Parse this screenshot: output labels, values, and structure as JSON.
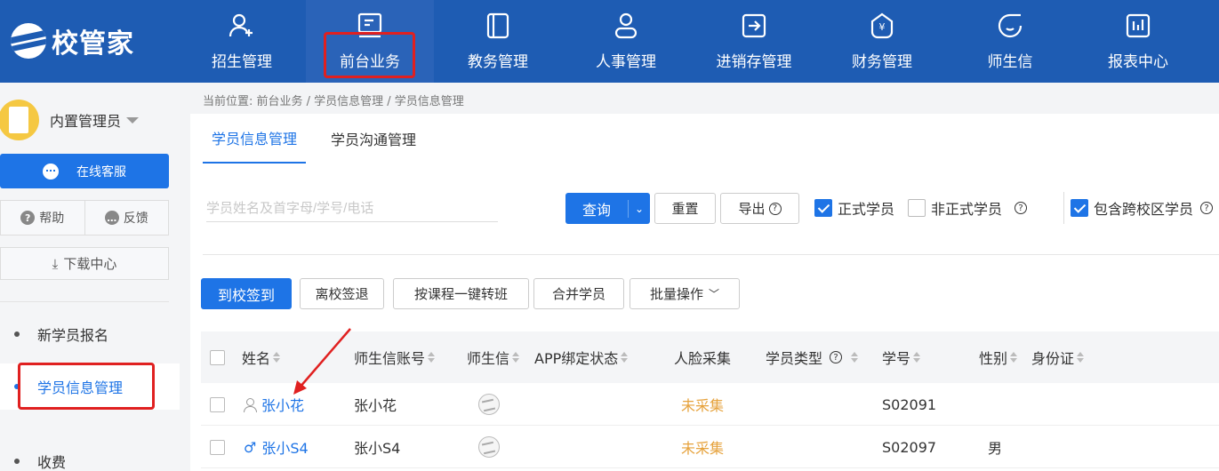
{
  "brand": {
    "name": "校管家"
  },
  "nav": [
    {
      "label": "招生管理",
      "icon": "user-plus-icon"
    },
    {
      "label": "前台业务",
      "icon": "desk-icon"
    },
    {
      "label": "教务管理",
      "icon": "book-icon"
    },
    {
      "label": "人事管理",
      "icon": "person-icon"
    },
    {
      "label": "进销存管理",
      "icon": "inventory-icon"
    },
    {
      "label": "财务管理",
      "icon": "money-icon"
    },
    {
      "label": "师生信",
      "icon": "chat-icon"
    },
    {
      "label": "报表中心",
      "icon": "report-icon"
    }
  ],
  "sidebar": {
    "user_name": "内置管理员",
    "service_label": "在线客服",
    "help_label": "帮助",
    "feedback_label": "反馈",
    "download_label": "下载中心",
    "menu": [
      {
        "label": "新学员报名"
      },
      {
        "label": "学员信息管理"
      },
      {
        "label": "收费"
      }
    ]
  },
  "breadcrumb": "当前位置: 前台业务 / 学员信息管理 / 学员信息管理",
  "tabs": [
    {
      "label": "学员信息管理"
    },
    {
      "label": "学员沟通管理"
    }
  ],
  "toolbar": {
    "search_placeholder": "学员姓名及首字母/学号/电话",
    "query_label": "查询",
    "reset_label": "重置",
    "export_label": "导出",
    "formal_label": "正式学员",
    "informal_label": "非正式学员",
    "cross_campus_label": "包含跨校区学员"
  },
  "actions": {
    "checkin": "到校签到",
    "checkout": "离校签退",
    "transfer": "按课程一键转班",
    "merge": "合并学员",
    "batch": "批量操作"
  },
  "table": {
    "columns": [
      "姓名",
      "师生信账号",
      "师生信",
      "APP绑定状态",
      "人脸采集",
      "学员类型",
      "学号",
      "性别",
      "身份证"
    ],
    "rows": [
      {
        "name": "张小花",
        "account": "张小花",
        "app_status": "",
        "face": "未采集",
        "type": "",
        "student_no": "S02091",
        "gender": "",
        "id_card": ""
      },
      {
        "name": "张小S4",
        "account": "张小S4",
        "app_status": "",
        "face": "未采集",
        "type": "",
        "student_no": "S02097",
        "gender": "男",
        "id_card": ""
      }
    ]
  }
}
